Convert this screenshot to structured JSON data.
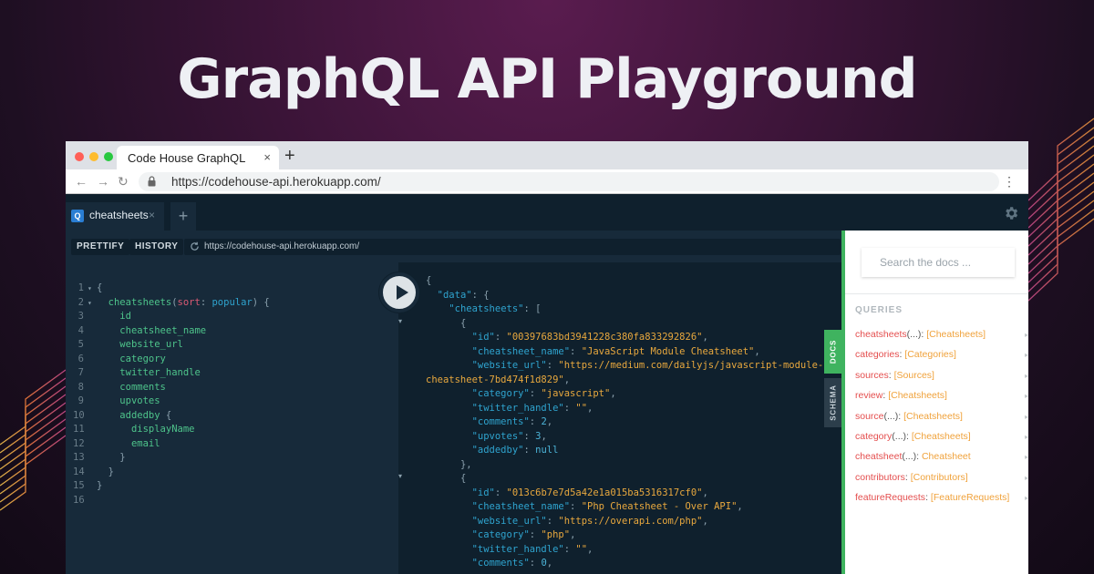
{
  "hero": {
    "title": "GraphQL API Playground"
  },
  "browser": {
    "tab_title": "Code House GraphQL",
    "tab_close": "×",
    "new_tab": "+",
    "url": "https://codehouse-api.herokuapp.com/",
    "nav": {
      "back": "←",
      "forward": "→",
      "reload": "↻",
      "menu": "⋮"
    },
    "traffic_lights": [
      "#ff5f57",
      "#febc2e",
      "#28c840"
    ]
  },
  "playground": {
    "tab": {
      "badge": "Q",
      "label": "cheatsheets",
      "close": "×"
    },
    "add_tab": "+",
    "toolbar": {
      "prettify": "PRETTIFY",
      "history": "HISTORY",
      "endpoint": "https://codehouse-api.herokuapp.com/"
    },
    "side_tabs": {
      "docs": "DOCS",
      "schema": "SCHEMA"
    },
    "docs": {
      "search_placeholder": "Search the docs ...",
      "queries_title": "QUERIES",
      "queries": [
        {
          "name": "cheatsheets",
          "args": "(...)",
          "type": "[Cheatsheets]"
        },
        {
          "name": "categories",
          "args": "",
          "type": "[Categories]"
        },
        {
          "name": "sources",
          "args": "",
          "type": "[Sources]"
        },
        {
          "name": "review",
          "args": "",
          "type": "[Cheatsheets]"
        },
        {
          "name": "source",
          "args": "(...)",
          "type": "[Cheatsheets]"
        },
        {
          "name": "category",
          "args": "(...)",
          "type": "[Cheatsheets]"
        },
        {
          "name": "cheatsheet",
          "args": "(...)",
          "type": "Cheatsheet"
        },
        {
          "name": "contributors",
          "args": "",
          "type": "[Contributors]"
        },
        {
          "name": "featureRequests",
          "args": "",
          "type": "[FeatureRequests]"
        }
      ]
    }
  },
  "query_editor": {
    "lines": [
      {
        "n": "1",
        "fold": "▾",
        "indent": 0,
        "open": "{",
        "field": "",
        "arg_name": "",
        "arg_value": "",
        "close": ""
      },
      {
        "n": "2",
        "fold": "▾",
        "indent": 1,
        "open": "",
        "field": "cheatsheets",
        "arg_name": "sort",
        "arg_value": "popular",
        "close": " {"
      },
      {
        "n": "3",
        "fold": "",
        "indent": 2,
        "open": "",
        "field": "id",
        "arg_name": "",
        "arg_value": "",
        "close": ""
      },
      {
        "n": "4",
        "fold": "",
        "indent": 2,
        "open": "",
        "field": "cheatsheet_name",
        "arg_name": "",
        "arg_value": "",
        "close": ""
      },
      {
        "n": "5",
        "fold": "",
        "indent": 2,
        "open": "",
        "field": "website_url",
        "arg_name": "",
        "arg_value": "",
        "close": ""
      },
      {
        "n": "6",
        "fold": "",
        "indent": 2,
        "open": "",
        "field": "category",
        "arg_name": "",
        "arg_value": "",
        "close": ""
      },
      {
        "n": "7",
        "fold": "",
        "indent": 2,
        "open": "",
        "field": "twitter_handle",
        "arg_name": "",
        "arg_value": "",
        "close": ""
      },
      {
        "n": "8",
        "fold": "",
        "indent": 2,
        "open": "",
        "field": "comments",
        "arg_name": "",
        "arg_value": "",
        "close": ""
      },
      {
        "n": "9",
        "fold": "",
        "indent": 2,
        "open": "",
        "field": "upvotes",
        "arg_name": "",
        "arg_value": "",
        "close": ""
      },
      {
        "n": "10",
        "fold": "",
        "indent": 2,
        "open": "",
        "field": "addedby",
        "arg_name": "",
        "arg_value": "",
        "close": " {"
      },
      {
        "n": "11",
        "fold": "",
        "indent": 3,
        "open": "",
        "field": "displayName",
        "arg_name": "",
        "arg_value": "",
        "close": ""
      },
      {
        "n": "12",
        "fold": "",
        "indent": 3,
        "open": "",
        "field": "email",
        "arg_name": "",
        "arg_value": "",
        "close": ""
      },
      {
        "n": "13",
        "fold": "",
        "indent": 2,
        "open": "}",
        "field": "",
        "arg_name": "",
        "arg_value": "",
        "close": ""
      },
      {
        "n": "14",
        "fold": "",
        "indent": 1,
        "open": "}",
        "field": "",
        "arg_name": "",
        "arg_value": "",
        "close": ""
      },
      {
        "n": "15",
        "fold": "",
        "indent": 0,
        "open": "}",
        "field": "",
        "arg_name": "",
        "arg_value": "",
        "close": ""
      },
      {
        "n": "16",
        "fold": "",
        "indent": 0,
        "open": "",
        "field": "",
        "arg_name": "",
        "arg_value": "",
        "close": ""
      }
    ]
  },
  "result_viewer": {
    "lines": [
      {
        "indent": 0,
        "pre": "{",
        "key": "",
        "value": "",
        "vtype": "",
        "post": ""
      },
      {
        "indent": 1,
        "pre": "",
        "key": "\"data\"",
        "value": "",
        "vtype": "",
        "post": ": {"
      },
      {
        "indent": 2,
        "pre": "",
        "key": "\"cheatsheets\"",
        "value": "",
        "vtype": "",
        "post": ": ["
      },
      {
        "indent": 3,
        "pre": "{",
        "key": "",
        "value": "",
        "vtype": "",
        "post": ""
      },
      {
        "indent": 4,
        "pre": "",
        "key": "\"id\"",
        "value": "\"00397683bd3941228c380fa833292826\"",
        "vtype": "s",
        "post": ","
      },
      {
        "indent": 4,
        "pre": "",
        "key": "\"cheatsheet_name\"",
        "value": "\"JavaScript Module Cheatsheet\"",
        "vtype": "s",
        "post": ","
      },
      {
        "indent": 4,
        "pre": "",
        "key": "\"website_url\"",
        "value": "\"https://medium.com/dailyjs/javascript-module-",
        "vtype": "s",
        "post": ""
      },
      {
        "indent": 0,
        "pre": "",
        "key": "",
        "value": "cheatsheet-7bd474f1d829\"",
        "vtype": "s",
        "post": ","
      },
      {
        "indent": 4,
        "pre": "",
        "key": "\"category\"",
        "value": "\"javascript\"",
        "vtype": "s",
        "post": ","
      },
      {
        "indent": 4,
        "pre": "",
        "key": "\"twitter_handle\"",
        "value": "\"\"",
        "vtype": "s",
        "post": ","
      },
      {
        "indent": 4,
        "pre": "",
        "key": "\"comments\"",
        "value": "2",
        "vtype": "n",
        "post": ","
      },
      {
        "indent": 4,
        "pre": "",
        "key": "\"upvotes\"",
        "value": "3",
        "vtype": "n",
        "post": ","
      },
      {
        "indent": 4,
        "pre": "",
        "key": "\"addedby\"",
        "value": "null",
        "vtype": "n",
        "post": ""
      },
      {
        "indent": 3,
        "pre": "},",
        "key": "",
        "value": "",
        "vtype": "",
        "post": ""
      },
      {
        "indent": 3,
        "pre": "{",
        "key": "",
        "value": "",
        "vtype": "",
        "post": ""
      },
      {
        "indent": 4,
        "pre": "",
        "key": "\"id\"",
        "value": "\"013c6b7e7d5a42e1a015ba5316317cf0\"",
        "vtype": "s",
        "post": ","
      },
      {
        "indent": 4,
        "pre": "",
        "key": "\"cheatsheet_name\"",
        "value": "\"Php Cheatsheet - Over API\"",
        "vtype": "s",
        "post": ","
      },
      {
        "indent": 4,
        "pre": "",
        "key": "\"website_url\"",
        "value": "\"https://overapi.com/php\"",
        "vtype": "s",
        "post": ","
      },
      {
        "indent": 4,
        "pre": "",
        "key": "\"category\"",
        "value": "\"php\"",
        "vtype": "s",
        "post": ","
      },
      {
        "indent": 4,
        "pre": "",
        "key": "\"twitter_handle\"",
        "value": "\"\"",
        "vtype": "s",
        "post": ","
      },
      {
        "indent": 4,
        "pre": "",
        "key": "\"comments\"",
        "value": "0",
        "vtype": "n",
        "post": ","
      }
    ]
  },
  "colors": {
    "accent_green": "#3fb35f",
    "editor_bg": "#172a3a",
    "result_bg": "#0f202d"
  }
}
